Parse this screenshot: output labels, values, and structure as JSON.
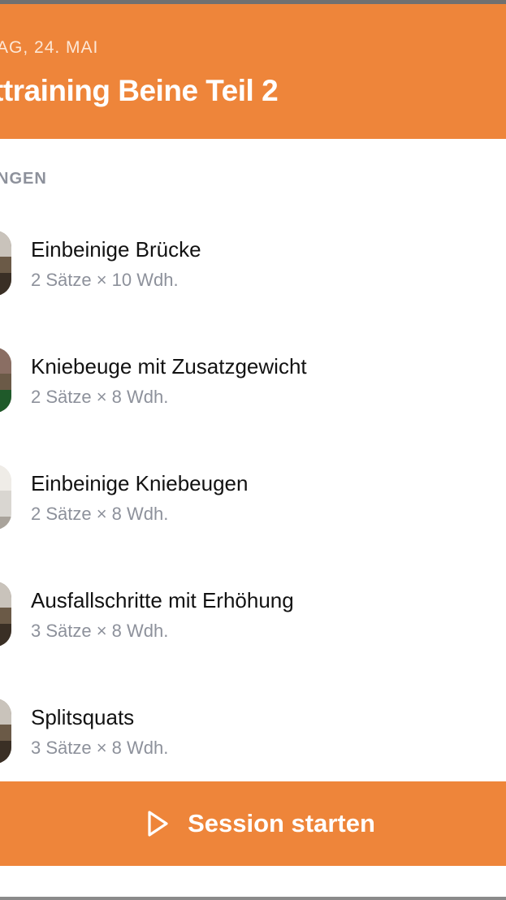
{
  "header": {
    "date": "AG, 24. MAI",
    "title": "ttraining Beine Teil 2"
  },
  "section_label": "NGEN",
  "exercises": [
    {
      "name": "Einbeinige Brücke",
      "sets": "2 Sätze × 10 Wdh."
    },
    {
      "name": "Kniebeuge mit Zusatzgewicht",
      "sets": "2 Sätze × 8 Wdh."
    },
    {
      "name": "Einbeinige Kniebeugen",
      "sets": "2 Sätze × 8 Wdh."
    },
    {
      "name": "Ausfallschritte mit Erhöhung",
      "sets": "3 Sätze × 8 Wdh."
    },
    {
      "name": "Splitsquats",
      "sets": "3 Sätze × 8 Wdh."
    }
  ],
  "start_button": {
    "label": "Session starten",
    "icon": "play-icon"
  },
  "colors": {
    "accent": "#ee853a",
    "secondary_text": "#8d919b"
  }
}
